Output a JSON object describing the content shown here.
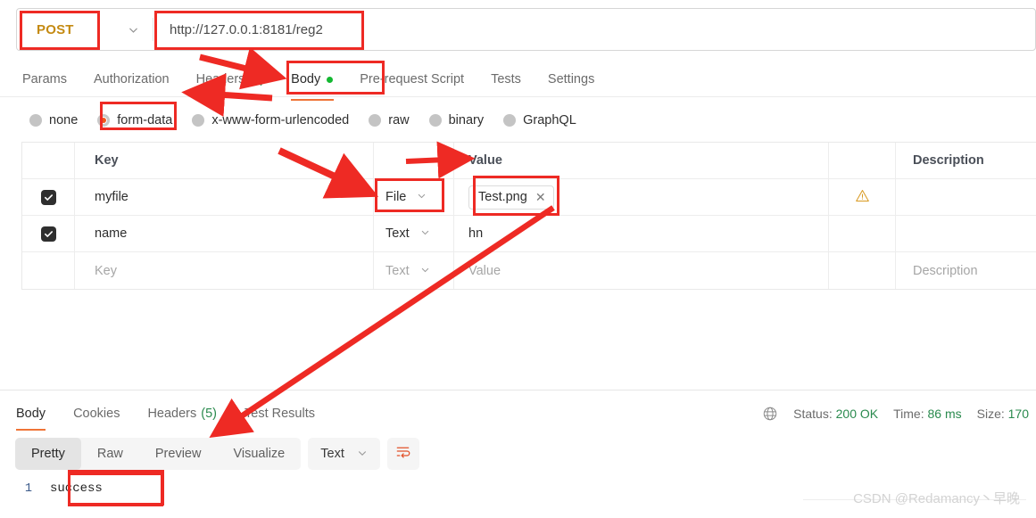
{
  "request": {
    "method": "POST",
    "method_caret_icon": "chevron-down-icon",
    "url": "http://127.0.0.1:8181/reg2",
    "tabs": [
      {
        "label": "Params",
        "active": false
      },
      {
        "label": "Authorization",
        "active": false
      },
      {
        "label": "Headers",
        "count": "(8)",
        "active": false
      },
      {
        "label": "Body",
        "active": true,
        "dot": true
      },
      {
        "label": "Pre-request Script",
        "active": false
      },
      {
        "label": "Tests",
        "active": false
      },
      {
        "label": "Settings",
        "active": false
      }
    ],
    "body_types": [
      {
        "label": "none",
        "selected": false
      },
      {
        "label": "form-data",
        "selected": true
      },
      {
        "label": "x-www-form-urlencoded",
        "selected": false
      },
      {
        "label": "raw",
        "selected": false
      },
      {
        "label": "binary",
        "selected": false
      },
      {
        "label": "GraphQL",
        "selected": false
      }
    ],
    "table": {
      "headers": {
        "key": "Key",
        "type": "",
        "value": "Value",
        "description": "Description"
      },
      "rows": [
        {
          "checked": true,
          "key": "myfile",
          "type": "File",
          "value_chip": "Test.png",
          "chip_close_icon": "close-icon",
          "warning_icon": "warning-triangle-icon",
          "description": ""
        },
        {
          "checked": true,
          "key": "name",
          "type": "Text",
          "value": "hn",
          "description": ""
        },
        {
          "checked": false,
          "key_placeholder": "Key",
          "type": "Text",
          "value_placeholder": "Value",
          "description_placeholder": "Description"
        }
      ]
    }
  },
  "response": {
    "tabs": [
      {
        "label": "Body",
        "active": true
      },
      {
        "label": "Cookies",
        "active": false
      },
      {
        "label": "Headers",
        "count": "(5)",
        "active": false
      },
      {
        "label": "Test Results",
        "active": false
      }
    ],
    "status": {
      "globe_icon": "globe-icon",
      "status_label": "Status:",
      "status_value": "200 OK",
      "time_label": "Time:",
      "time_value": "86 ms",
      "size_label": "Size:",
      "size_value": "170"
    },
    "view_modes": [
      {
        "label": "Pretty",
        "active": true
      },
      {
        "label": "Raw",
        "active": false
      },
      {
        "label": "Preview",
        "active": false
      },
      {
        "label": "Visualize",
        "active": false
      }
    ],
    "format": "Text",
    "format_caret_icon": "chevron-down-icon",
    "wrap_icon": "word-wrap-icon",
    "body": {
      "line_number": "1",
      "text": "success"
    }
  },
  "watermark": "CSDN @Redamancy丶早晚",
  "colors": {
    "method_accent": "#c48a12",
    "active_tab_underline": "#ef7437",
    "status_green": "#2a8a4e",
    "body_dot_green": "#14b832",
    "radio_selected": "#f0561d",
    "annotation_red": "#ee2a24",
    "warning_amber": "#d99a21"
  }
}
